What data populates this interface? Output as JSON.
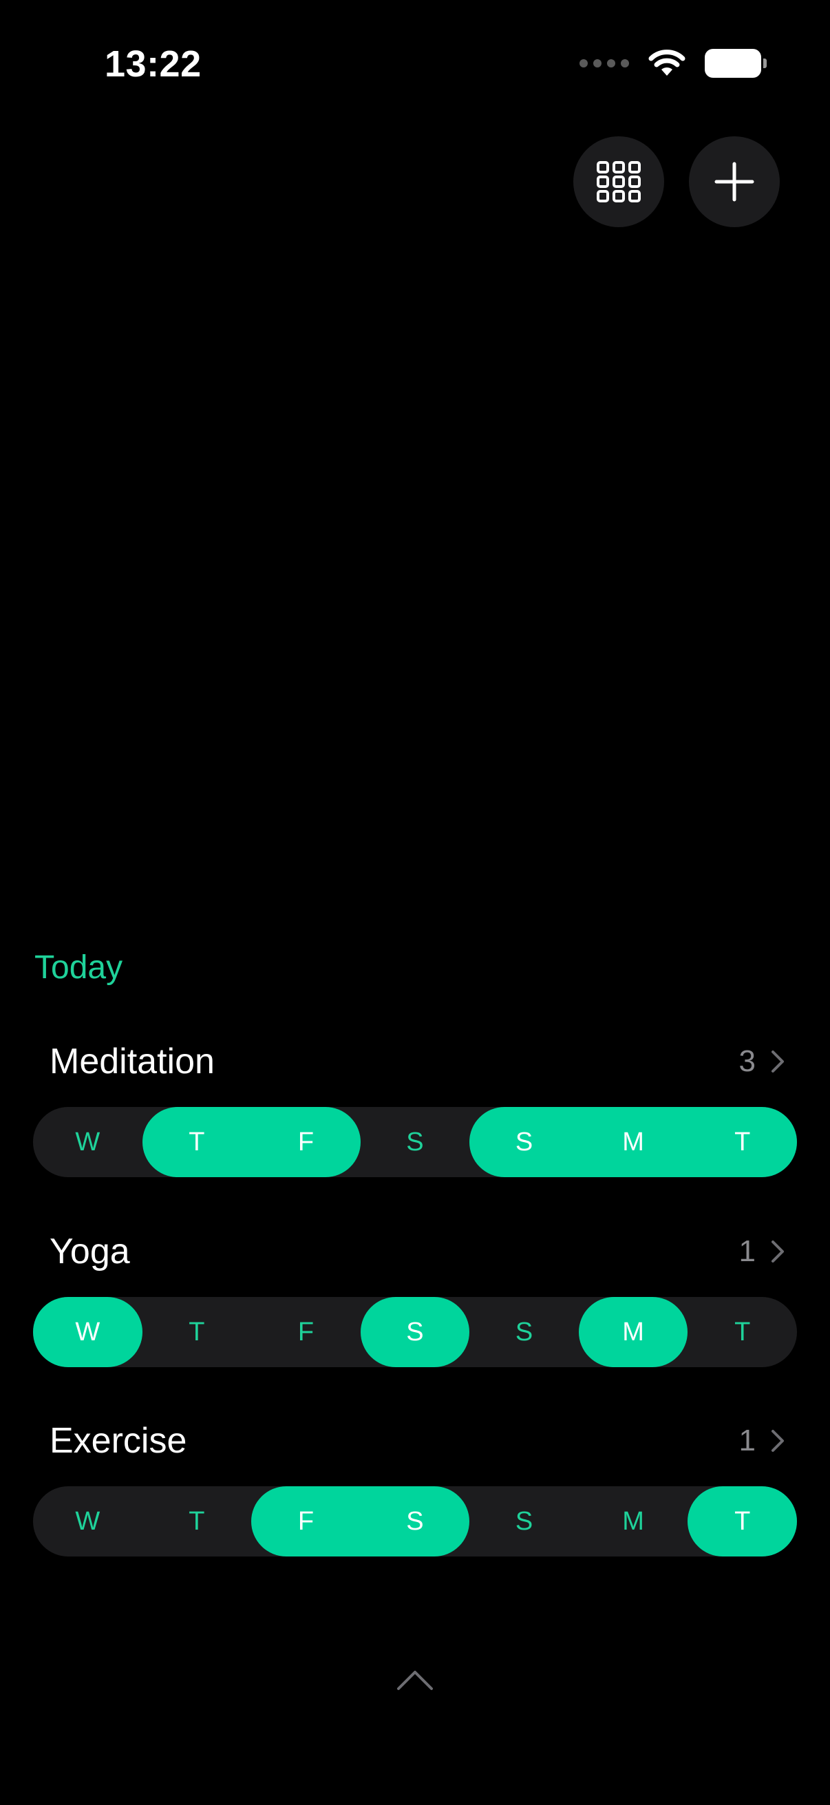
{
  "status_bar": {
    "time": "13:22"
  },
  "toolbar": {
    "grid_icon": "grid-icon",
    "add_icon": "plus-icon"
  },
  "section": {
    "title": "Today"
  },
  "colors": {
    "accent": "#00d59c",
    "accent_text": "#1fd29a",
    "track": "#1c1c1e",
    "background": "#000000"
  },
  "habits": [
    {
      "name": "Meditation",
      "count": "3",
      "days": [
        {
          "label": "W",
          "done": false
        },
        {
          "label": "T",
          "done": true
        },
        {
          "label": "F",
          "done": true
        },
        {
          "label": "S",
          "done": false
        },
        {
          "label": "S",
          "done": true
        },
        {
          "label": "M",
          "done": true
        },
        {
          "label": "T",
          "done": true
        }
      ]
    },
    {
      "name": "Yoga",
      "count": "1",
      "days": [
        {
          "label": "W",
          "done": true
        },
        {
          "label": "T",
          "done": false
        },
        {
          "label": "F",
          "done": false
        },
        {
          "label": "S",
          "done": true
        },
        {
          "label": "S",
          "done": false
        },
        {
          "label": "M",
          "done": true
        },
        {
          "label": "T",
          "done": false
        }
      ]
    },
    {
      "name": "Exercise",
      "count": "1",
      "days": [
        {
          "label": "W",
          "done": false
        },
        {
          "label": "T",
          "done": false
        },
        {
          "label": "F",
          "done": true
        },
        {
          "label": "S",
          "done": true
        },
        {
          "label": "S",
          "done": false
        },
        {
          "label": "M",
          "done": false
        },
        {
          "label": "T",
          "done": true
        }
      ]
    }
  ]
}
